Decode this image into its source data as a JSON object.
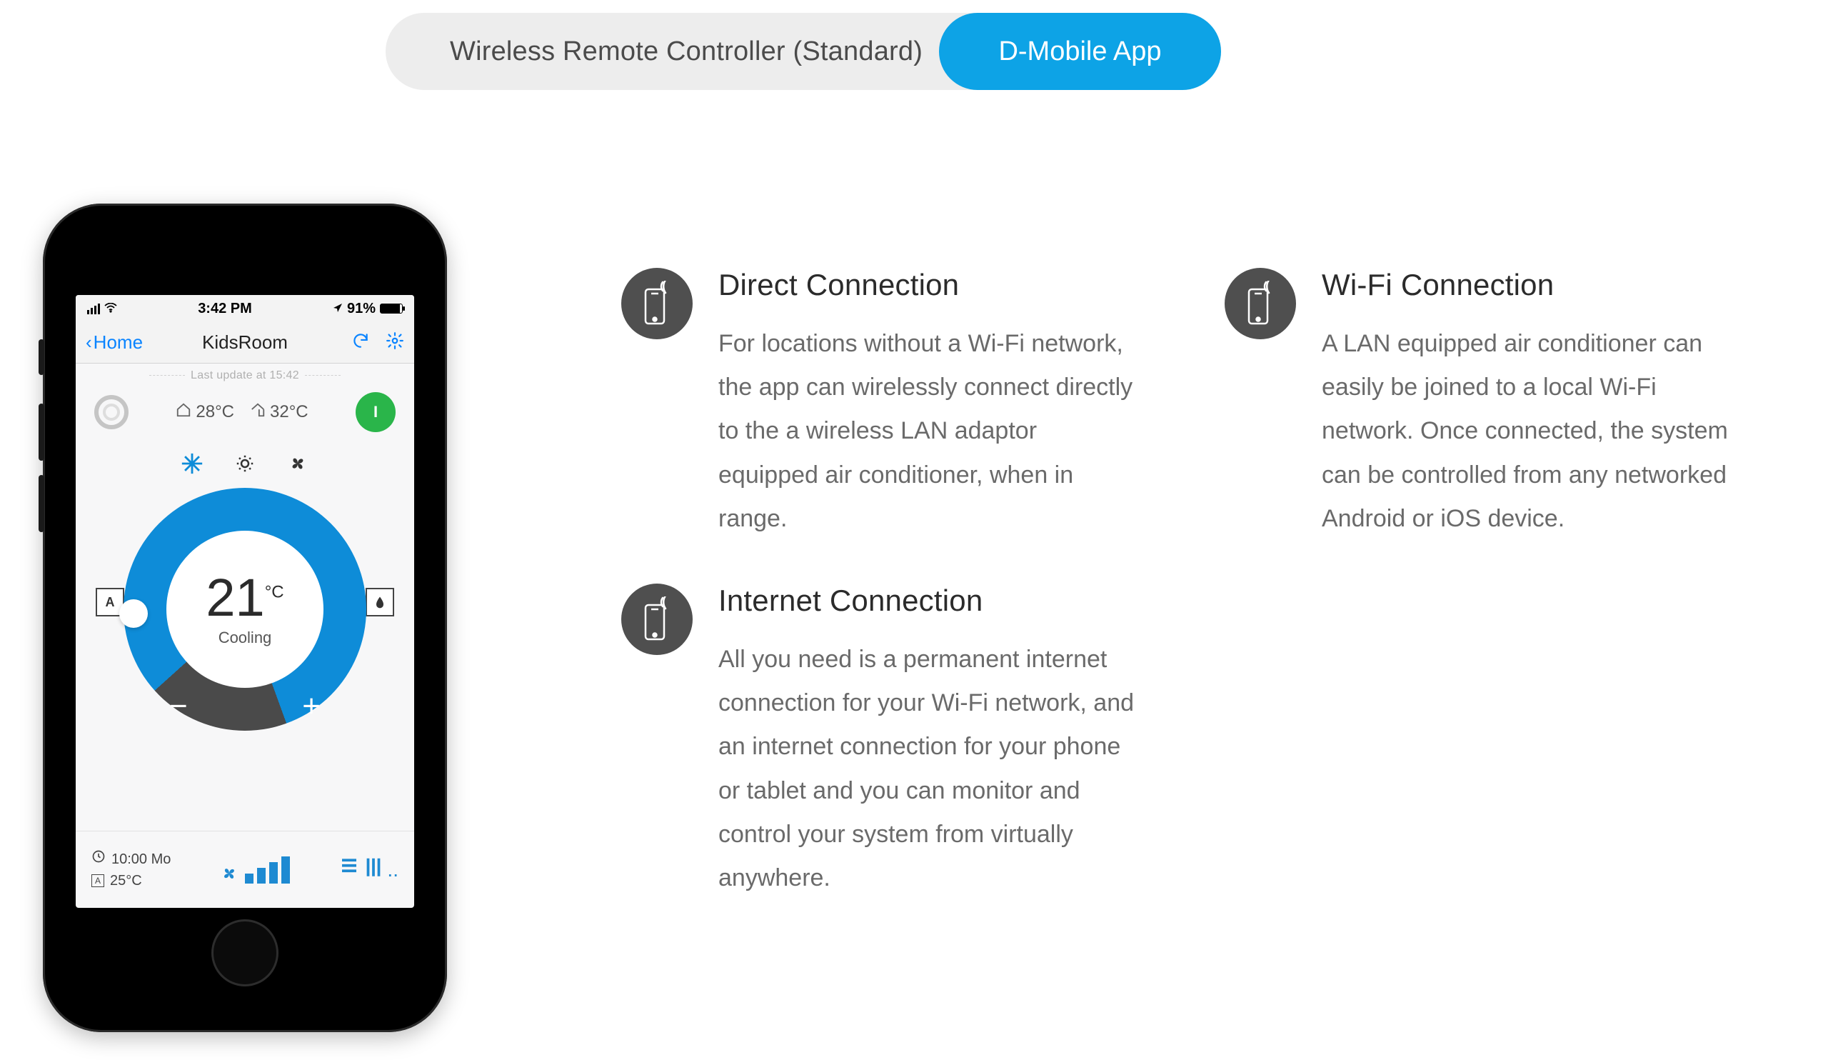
{
  "toggle": {
    "inactive_label": "Wireless Remote Controller (Standard)",
    "active_label": "D-Mobile App"
  },
  "phone": {
    "status": {
      "time": "3:42 PM",
      "battery_pct": "91%"
    },
    "nav": {
      "back": "Home",
      "title": "KidsRoom"
    },
    "last_update": "Last update at 15:42",
    "temps": {
      "indoor": "28°C",
      "outdoor": "32°C"
    },
    "power_icon": "I",
    "dial": {
      "temp": "21",
      "unit": "°C",
      "mode": "Cooling",
      "minus": "−",
      "plus": "+"
    },
    "side_left": "A",
    "side_right": "●",
    "footer": {
      "sched_time": "10:00 Mo",
      "sched_temp": "25°C",
      "setpoint_box": "A"
    }
  },
  "features": [
    {
      "title": "Direct Connection",
      "body": "For locations without a Wi-Fi network, the app can wirelessly connect directly to the a wireless LAN adaptor equipped air conditioner, when in range."
    },
    {
      "title": "Wi-Fi Connection",
      "body": "A LAN equipped air conditioner can easily be joined to a local Wi-Fi network. Once connected, the system can be controlled from any networked Android or iOS device."
    },
    {
      "title": "Internet Connection",
      "body": "All you need is a permanent internet connection for your Wi-Fi network, and an internet connection for your phone or tablet and you can monitor and control your system from virtually anywhere."
    }
  ]
}
